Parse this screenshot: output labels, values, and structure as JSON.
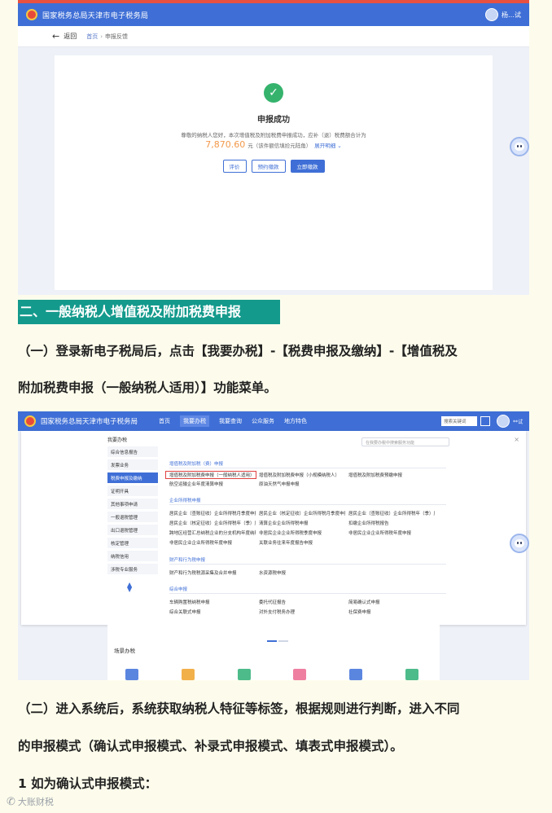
{
  "shot1": {
    "agency_title": "国家税务总局天津市电子税务局",
    "user_name": "杨…试",
    "back_label": "返回",
    "breadcrumb_home": "首页",
    "breadcrumb_sep": "›",
    "breadcrumb_current": "申报反馈",
    "success_title": "申报成功",
    "success_message": "尊敬的纳税人您好，本次增值税及附加税费申报成功，应补（退）税费额合计为",
    "amount": "7,870.60",
    "amount_suffix": "元（该件额信填捡元陆角）",
    "expand_link": "展开明细 ⌄",
    "buttons": [
      "评价",
      "预约缴款",
      "立即缴款"
    ],
    "check_glyph": "✓"
  },
  "heading": "二、一般纳税人增值税及附加税费申报",
  "para1_line1": "（一）登录新电子税局后，点击【我要办税】-【税费申报及缴纳】-【增值税及",
  "para1_line2": "附加税费申报（一般纳税人适用）】功能菜单。",
  "shot2": {
    "agency_title": "国家税务总局天津市电子税务局",
    "nav": [
      "首页",
      "我要办税",
      "我要查询",
      "公众服务",
      "地方特色"
    ],
    "nav_active_index": 1,
    "search_placeholder": "搜索关键词",
    "user_name": "**试",
    "sidebar_head": "我要办税",
    "sidebar_items": [
      "综合信息报告",
      "发票业务",
      "税费申报及缴纳",
      "证明开具",
      "其他事项申请",
      "一般退税管理",
      "出口退税管理",
      "核定管理",
      "纳税信用",
      "涉税专业服务"
    ],
    "sidebar_active_index": 2,
    "menu_search_placeholder": "在我要办税中搜索服务功能",
    "close_glyph": "×",
    "groups": {
      "vat": "增值税及附加税（费）申报",
      "cit": "企业所得税申报",
      "prop": "财产和行为税申报",
      "other": "综合申报"
    },
    "vat_rows": [
      [
        "增值税及附加税费申报（一般纳税人适用）",
        "增值税及附加税费申报（小规模纳税人）",
        "增值税及附加税费预缴申报"
      ],
      [
        "航空运输企业年度清算申报",
        "原油天然气申报申报",
        ""
      ]
    ],
    "cit_rows": [
      [
        "居民企业（查账征收）企业所得税月季度申报",
        "居民企业（核定征收）企业所得税月季度申报",
        "居民企业（查账征收）企业所得税年（季）度..."
      ],
      [
        "居民企业（核定征收）企业所得税年（季）度...",
        "清算企业企业所得税申报",
        "扣缴企业所得税报告"
      ],
      [
        "跨地区经营汇总纳税企业的分支机构年度纳税...",
        "非居民企业企业所得税季度申报",
        "非居民企业企业所得税年度申报"
      ],
      [
        "非居民企业企业所得税年度申报",
        "关联业务往来年度报告申报",
        ""
      ]
    ],
    "prop_rows": [
      [
        "财产和行为税税源采集及合并申报",
        "水资源税申报",
        ""
      ]
    ],
    "other_rows": [
      [
        "车辆购置税纳税申报",
        "委托代征报告",
        "简易确认式申报"
      ],
      [
        "综合关联式申报",
        "对外支付税务办理",
        "社保费申报"
      ]
    ],
    "scene_title": "场景办税"
  },
  "para2_line1": "（二）进入系统后，系统获取纳税人特征等标签，根据规则进行判断，进入不同",
  "para2_line2": "的申报模式（确认式申报模式、补录式申报模式、填表式申报模式）。",
  "para3": "1 如为确认式申报模式：",
  "watermark": "大账财税",
  "colors": {
    "page_bg": "#fdfcec",
    "heading_bg": "#149a8c",
    "brand_blue": "#3f6fd6",
    "success_green": "#35b36d",
    "amount_orange": "#f2994a"
  }
}
